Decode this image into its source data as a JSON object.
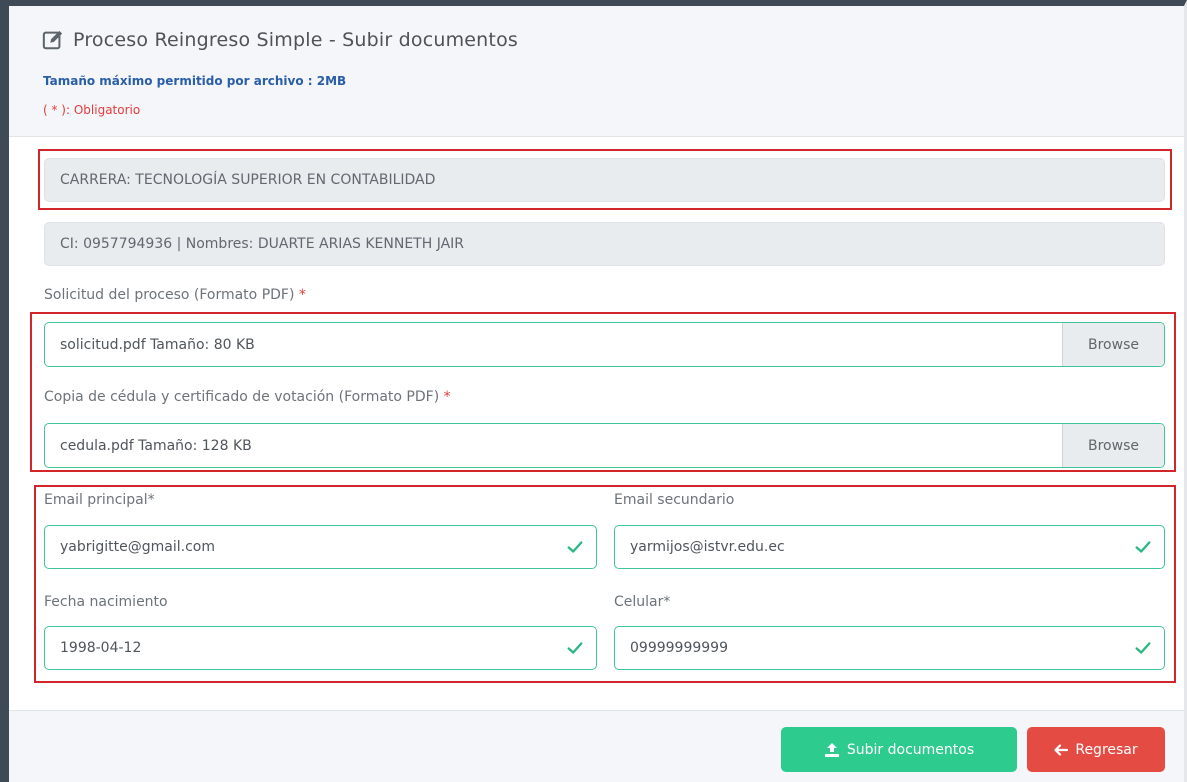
{
  "header": {
    "title": "Proceso Reingreso Simple - Subir documentos",
    "title_icon": "edit-icon",
    "max_size_note": "Tamaño máximo permitido por archivo : 2MB",
    "required_note": "( * ): Obligatorio"
  },
  "info": {
    "carrera": "CARRERA: TECNOLOGÍA SUPERIOR EN CONTABILIDAD",
    "student": "CI: 0957794936 | Nombres: DUARTE ARIAS KENNETH JAIR"
  },
  "files": [
    {
      "label": "Solicitud del proceso (Formato PDF)",
      "required_mark": "*",
      "value": "solicitud.pdf Tamaño: 80 KB",
      "button": "Browse"
    },
    {
      "label": "Copia de cédula y certificado de votación (Formato PDF)",
      "required_mark": "*",
      "value": "cedula.pdf Tamaño: 128 KB",
      "button": "Browse"
    }
  ],
  "fields": {
    "email_principal": {
      "label": "Email principal*",
      "value": "yabrigitte@gmail.com"
    },
    "email_secundario": {
      "label": "Email secundario",
      "value": "yarmijos@istvr.edu.ec"
    },
    "fecha_nacimiento": {
      "label": "Fecha nacimiento",
      "value": "1998-04-12"
    },
    "celular": {
      "label": "Celular*",
      "value": "09999999999"
    }
  },
  "actions": {
    "upload": "Subir documentos",
    "back": "Regresar"
  },
  "colors": {
    "valid_border": "#3fc49b",
    "success": "#2dcb8e",
    "danger": "#e44b42",
    "highlight": "#d2262b",
    "link_blue": "#2a5ea8"
  }
}
